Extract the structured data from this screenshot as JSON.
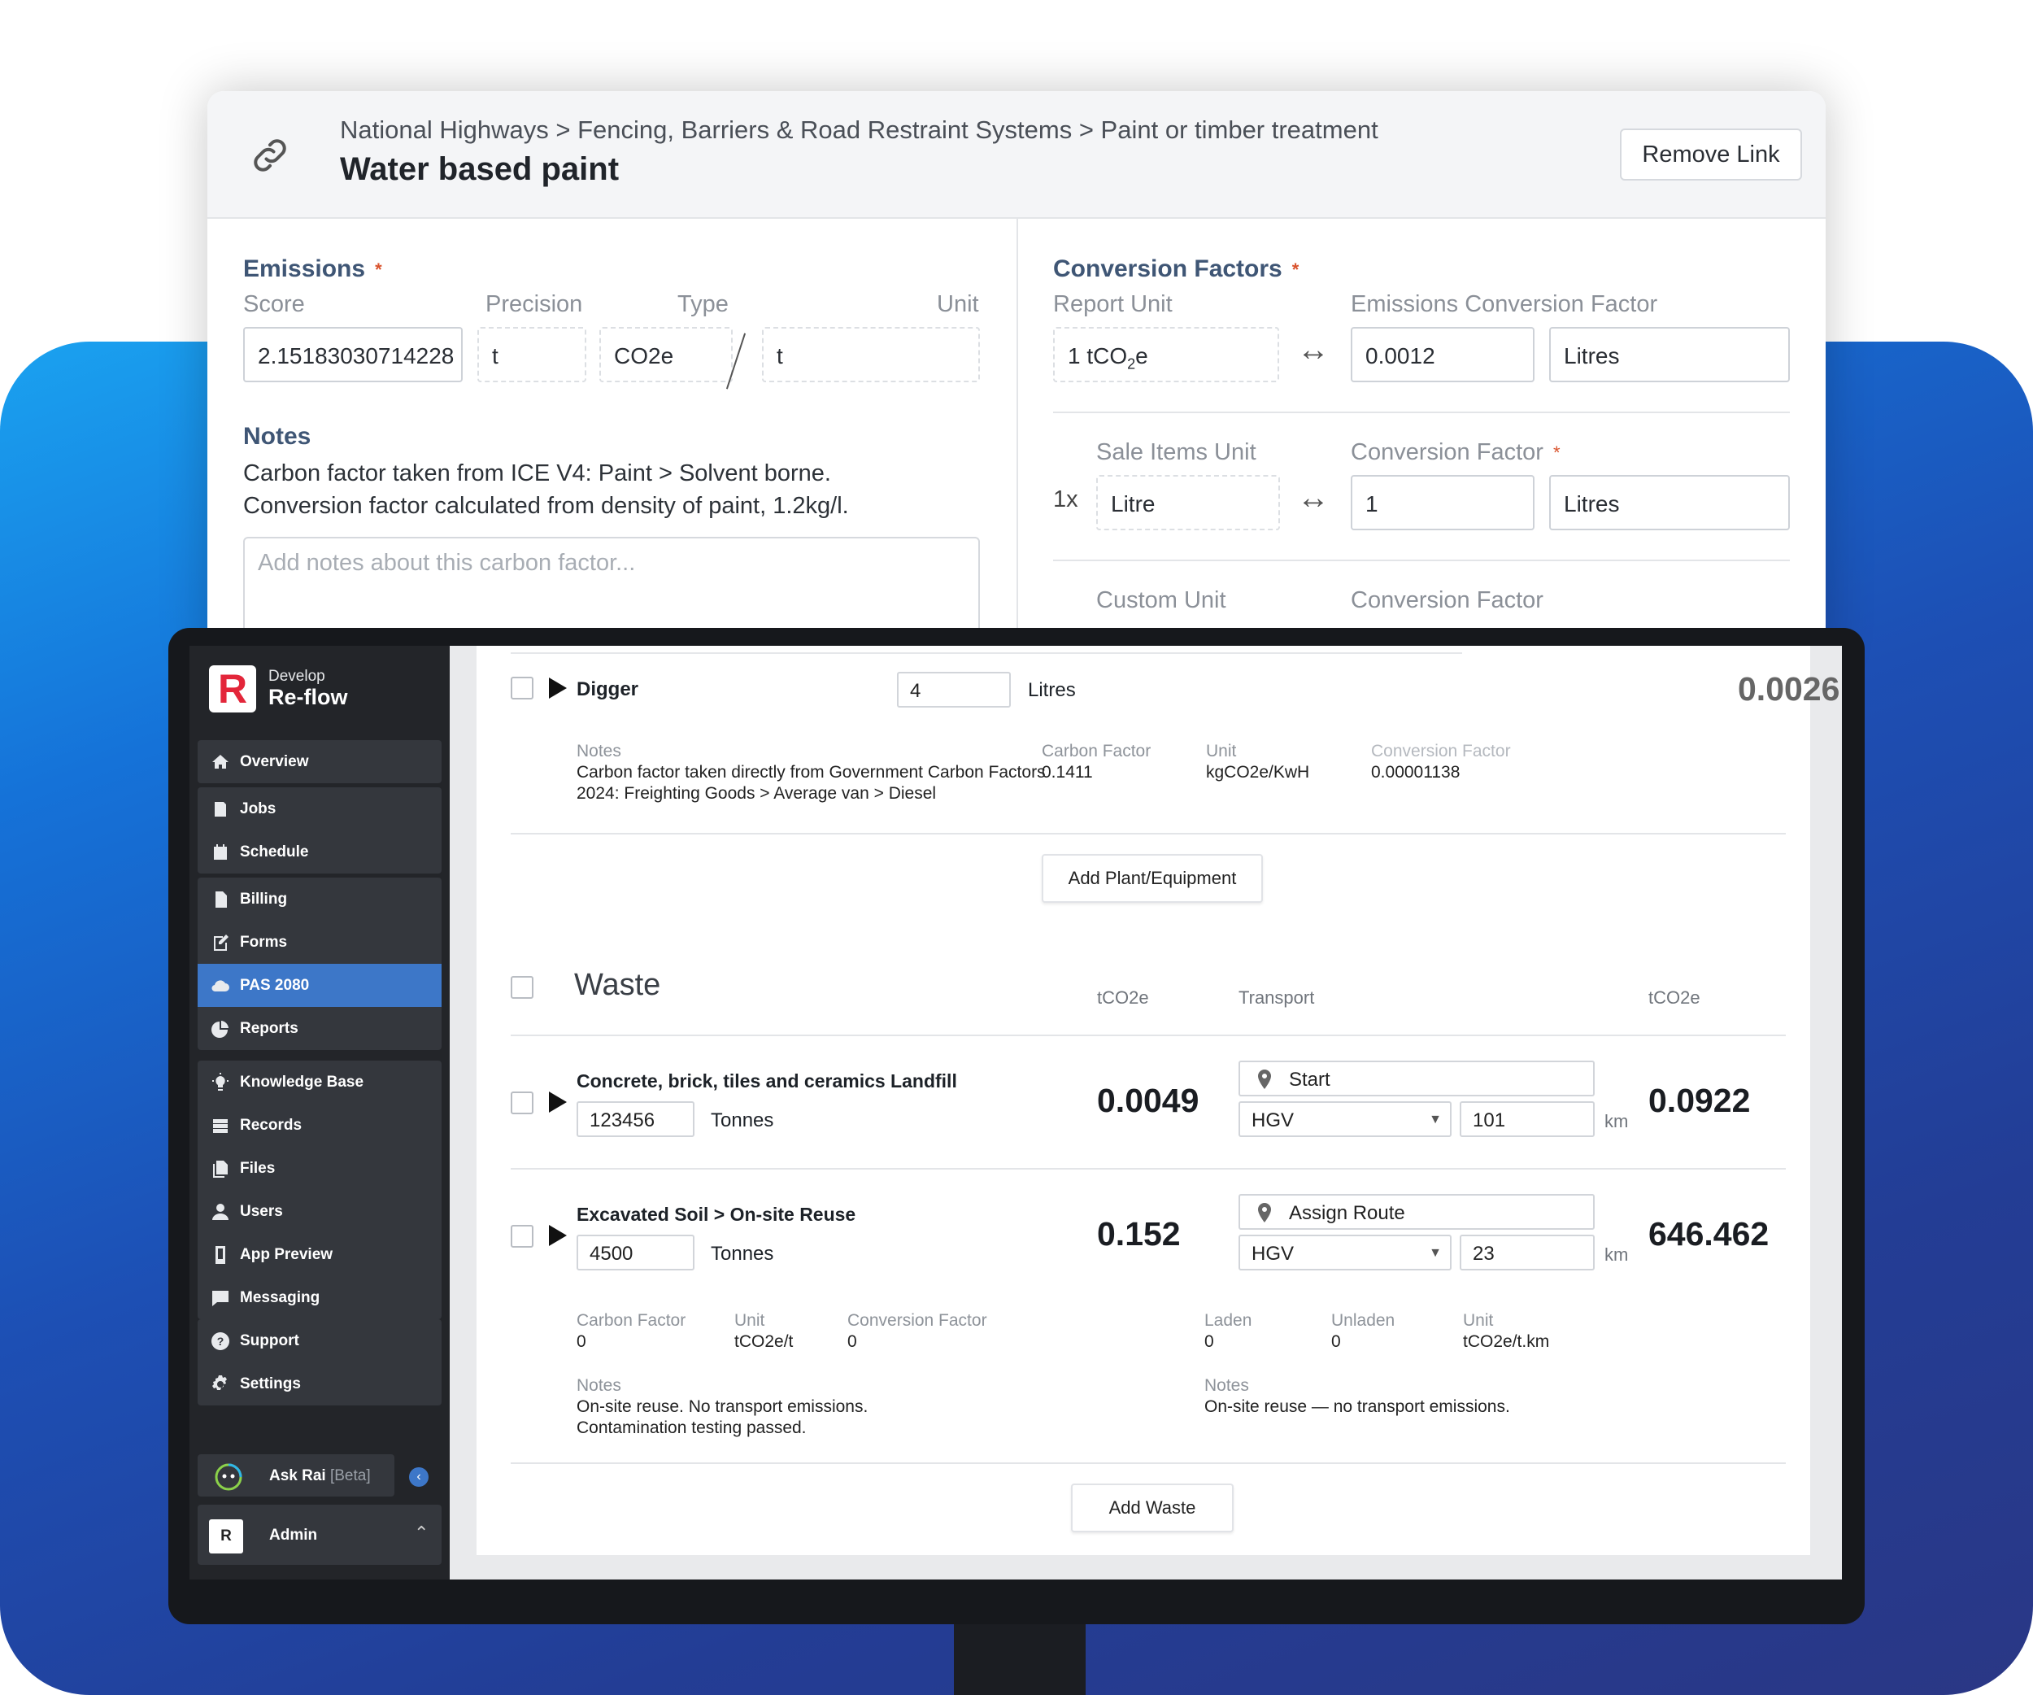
{
  "link_panel": {
    "breadcrumb": "National Highways > Fencing, Barriers & Road Restraint Systems > Paint or timber treatment",
    "title": "Water based paint",
    "remove_link": "Remove Link",
    "emissions": {
      "heading": "Emissions",
      "required_mark": "*",
      "score_label": "Score",
      "precision_label": "Precision",
      "type_label": "Type",
      "unit_label": "Unit",
      "score_value": "2.15183030714228",
      "precision_value": "t",
      "type_value": "CO2e",
      "unit_value": "t"
    },
    "notes": {
      "heading": "Notes",
      "line1": "Carbon factor taken from ICE V4: Paint > Solvent borne.",
      "line2": "Conversion factor calculated from density of paint, 1.2kg/l.",
      "placeholder": "Add notes about this carbon factor..."
    },
    "conversion": {
      "heading": "Conversion Factors",
      "required_mark": "*",
      "report_unit_label": "Report Unit",
      "emissions_cf_label": "Emissions Conversion Factor",
      "report_unit_prefix": "1 tCO",
      "report_unit_sub": "2",
      "report_unit_suffix": "e",
      "emissions_cf_value": "0.0012",
      "emissions_cf_unit": "Litres",
      "sale_items_unit_label": "Sale Items Unit",
      "conversion_factor_label": "Conversion Factor",
      "multiplier": "1x",
      "sale_items_unit_value": "Litre",
      "conversion_factor_value": "1",
      "conversion_factor_unit": "Litres",
      "custom_unit_label": "Custom Unit",
      "custom_cf_label": "Conversion Factor"
    }
  },
  "sidebar": {
    "brand_small": "Develop",
    "brand_big": "Re-flow",
    "brand_letter": "R",
    "items": [
      {
        "label": "Overview",
        "icon": "home-icon"
      },
      {
        "label": "Jobs",
        "icon": "jobs-icon"
      },
      {
        "label": "Schedule",
        "icon": "calendar-icon"
      },
      {
        "label": "Billing",
        "icon": "billing-icon"
      },
      {
        "label": "Forms",
        "icon": "forms-icon"
      },
      {
        "label": "PAS 2080",
        "icon": "cloud-icon",
        "active": true
      },
      {
        "label": "Reports",
        "icon": "pie-chart-icon"
      },
      {
        "label": "Knowledge Base",
        "icon": "lightbulb-icon"
      },
      {
        "label": "Records",
        "icon": "records-icon"
      },
      {
        "label": "Files",
        "icon": "files-icon"
      },
      {
        "label": "Users",
        "icon": "user-icon"
      },
      {
        "label": "App Preview",
        "icon": "phone-icon"
      },
      {
        "label": "Messaging",
        "icon": "chat-icon"
      },
      {
        "label": "Support",
        "icon": "help-icon"
      },
      {
        "label": "Settings",
        "icon": "gear-icon"
      }
    ],
    "ask_rai": "Ask Rai",
    "ask_rai_beta": "[Beta]",
    "admin_initial": "R",
    "admin_label": "Admin"
  },
  "plant": {
    "item_name": "Digger",
    "quantity": "4",
    "quantity_unit": "Litres",
    "total": "0.0026",
    "notes_label": "Notes",
    "notes_line1": "Carbon factor taken directly from Government Carbon Factors",
    "notes_line2": "2024: Freighting Goods > Average van > Diesel",
    "carbon_factor_label": "Carbon Factor",
    "carbon_factor_value": "0.1411",
    "unit_label": "Unit",
    "unit_value": "kgCO2e/KwH",
    "conversion_factor_label": "Conversion Factor",
    "conversion_factor_value": "0.00001138",
    "add_button": "Add Plant/Equipment"
  },
  "waste": {
    "heading": "Waste",
    "col_tco2e": "tCO2e",
    "col_transport": "Transport",
    "col_tco2e_2": "tCO2e",
    "rows": [
      {
        "name": "Concrete, brick, tiles and ceramics Landfill",
        "quantity": "123456",
        "quantity_unit": "Tonnes",
        "tco2e": "0.0049",
        "route": "Start",
        "vehicle": "HGV",
        "distance": "101",
        "distance_unit": "km",
        "transport_tco2e": "0.0922"
      },
      {
        "name": "Excavated Soil > On-site Reuse",
        "quantity": "4500",
        "quantity_unit": "Tonnes",
        "tco2e": "0.152",
        "route": "Assign Route",
        "vehicle": "HGV",
        "distance": "23",
        "distance_unit": "km",
        "transport_tco2e": "646.462"
      }
    ],
    "details": {
      "carbon_factor_label": "Carbon Factor",
      "carbon_factor_value": "0",
      "unit_label": "Unit",
      "unit_value": "tCO2e/t",
      "conversion_factor_label": "Conversion Factor",
      "conversion_factor_value": "0",
      "laden_label": "Laden",
      "laden_value": "0",
      "unladen_label": "Unladen",
      "unladen_value": "0",
      "transport_unit_label": "Unit",
      "transport_unit_value": "tCO2e/t.km",
      "notes_label": "Notes",
      "notes_line1": "On-site reuse. No transport emissions.",
      "notes_line2": "Contamination testing passed.",
      "transport_notes_label": "Notes",
      "transport_notes": "On-site reuse — no transport emissions."
    },
    "add_button": "Add Waste"
  },
  "colors": {
    "accent": "#3d77c8",
    "brand_red": "#e3263a",
    "sidebar_bg": "#232529",
    "required": "#d9522c"
  }
}
